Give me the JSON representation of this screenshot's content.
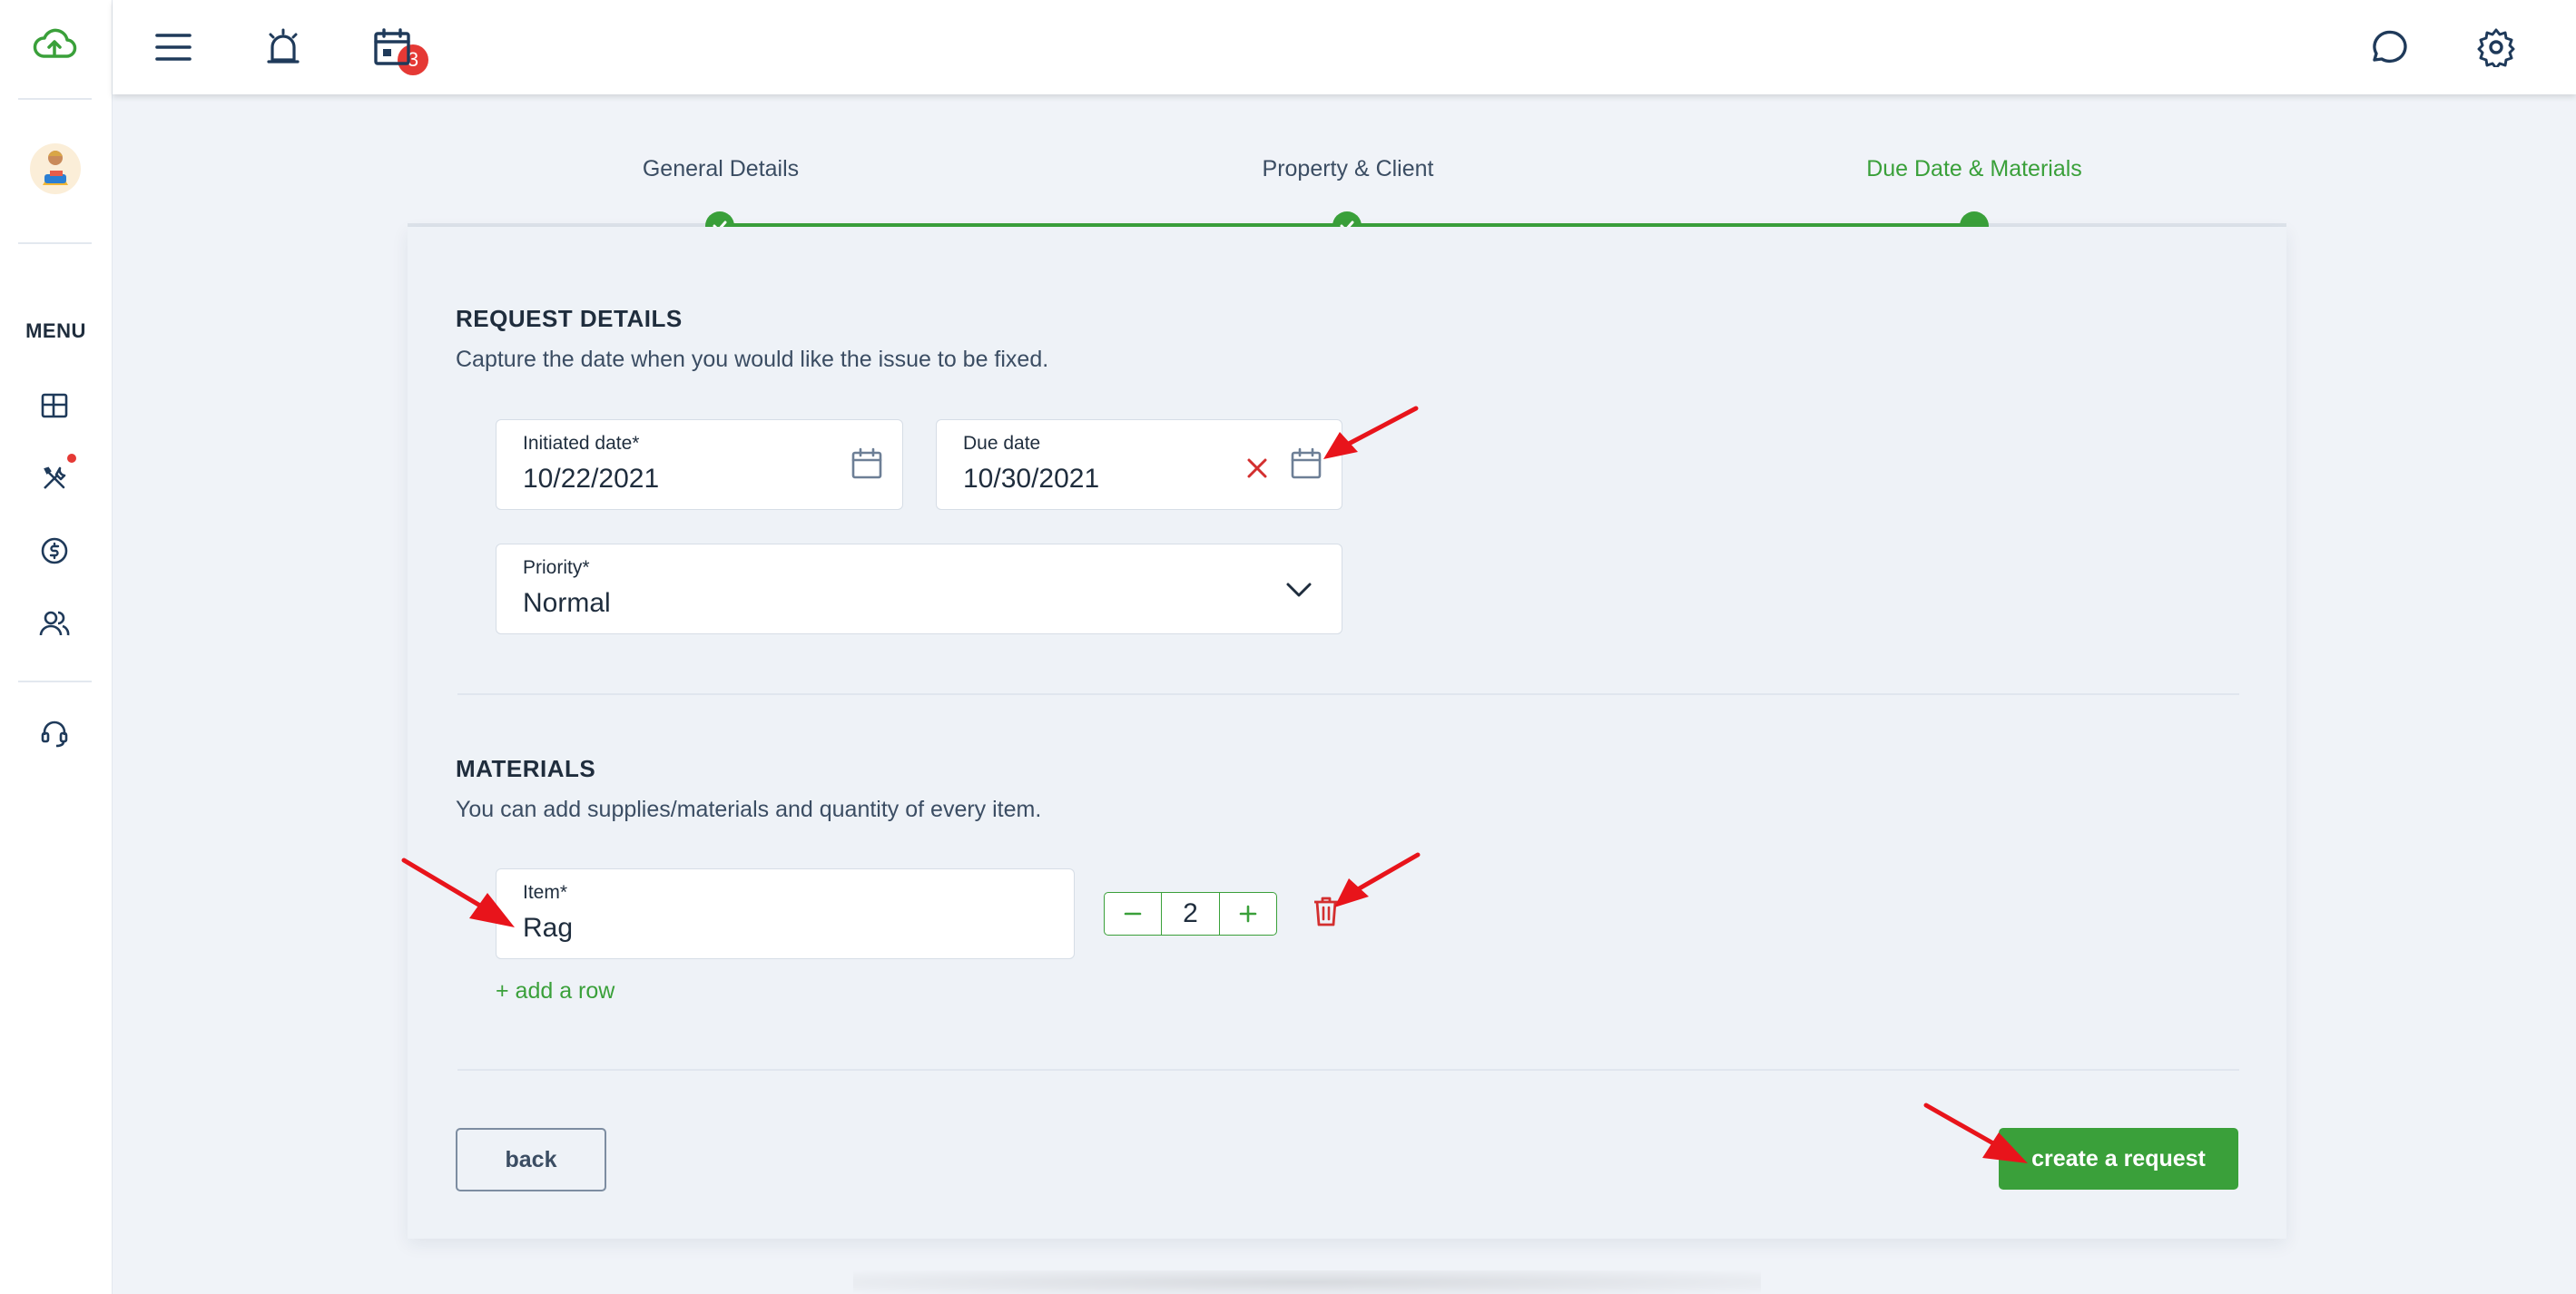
{
  "colors": {
    "accent": "#3aa03a",
    "danger": "#e53935",
    "text": "#1f2d3d",
    "muted": "#3b4d63"
  },
  "sidebar": {
    "menu_label": "MENU",
    "icons": [
      "cloud-upload-icon",
      "avatar",
      "dashboard-icon",
      "tools-icon",
      "dollar-icon",
      "users-icon",
      "headset-icon"
    ]
  },
  "topbar": {
    "notification_count": "3",
    "icons": [
      "hamburger-menu-icon",
      "alarm-icon",
      "calendar-icon",
      "chat-icon",
      "gear-icon"
    ]
  },
  "stepper": {
    "steps": [
      {
        "label": "General Details",
        "state": "done"
      },
      {
        "label": "Property & Client",
        "state": "done"
      },
      {
        "label": "Due Date & Materials",
        "state": "active"
      }
    ]
  },
  "request_details": {
    "title": "REQUEST DETAILS",
    "subtitle": "Capture the date when you would like the issue to be fixed.",
    "initiated_date": {
      "label": "Initiated date*",
      "value": "10/22/2021"
    },
    "due_date": {
      "label": "Due date",
      "value": "10/30/2021"
    },
    "priority": {
      "label": "Priority*",
      "value": "Normal"
    }
  },
  "materials": {
    "title": "MATERIALS",
    "subtitle": "You can add supplies/materials and quantity of every item.",
    "item": {
      "label": "Item*",
      "value": "Rag"
    },
    "quantity": "2",
    "add_row_label": "+ add a row"
  },
  "actions": {
    "back_label": "back",
    "create_label": "create a request"
  }
}
